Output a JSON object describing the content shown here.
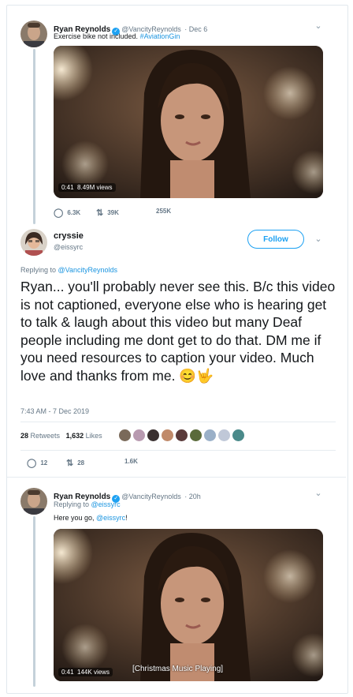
{
  "tweet1": {
    "name": "Ryan Reynolds",
    "handle": "@VancityReynolds",
    "date": "· Dec 6",
    "text_prefix": "Exercise bike not included. ",
    "hashtag": "#AviationGin",
    "video_time": "0:41",
    "video_views": "8.49M views",
    "replies": "6.3K",
    "retweets": "39K",
    "likes": "255K"
  },
  "tweet2": {
    "name": "cryssie",
    "handle": "@eissyrc",
    "follow_label": "Follow",
    "replying_to": "Replying to ",
    "replying_handle": "@VancityReynolds",
    "text": "Ryan... you'll probably never see this. B/c this video is not captioned, everyone else who is hearing get to talk & laugh about this video but many Deaf people including me dont get to do that. DM me if you need resources to caption your video. Much love and thanks from me. 😊🤟",
    "timestamp": "7:43 AM - 7 Dec 2019",
    "retweets_count": "28",
    "retweets_label": "Retweets",
    "likes_count": "1,632",
    "likes_label": "Likes",
    "replies": "12",
    "retweets": "28",
    "likes": "1.6K"
  },
  "tweet3": {
    "name": "Ryan Reynolds",
    "handle": "@VancityReynolds",
    "date": "· 20h",
    "replying_to": "Replying to ",
    "replying_handle": "@eissyrc",
    "text_prefix": "Here you go, ",
    "text_mention": "@eissyrc",
    "text_suffix": "!",
    "video_time": "0:41",
    "video_views": "144K views",
    "caption": "[Christmas Music Playing]"
  },
  "icons": {
    "reply": "reply-icon",
    "retweet": "retweet-icon",
    "like": "like-icon",
    "chevron": "chevron-down-icon",
    "verified": "verified-badge-icon"
  },
  "colors": {
    "accent": "#1da1f2",
    "link": "#1b95e0",
    "muted": "#657786"
  }
}
